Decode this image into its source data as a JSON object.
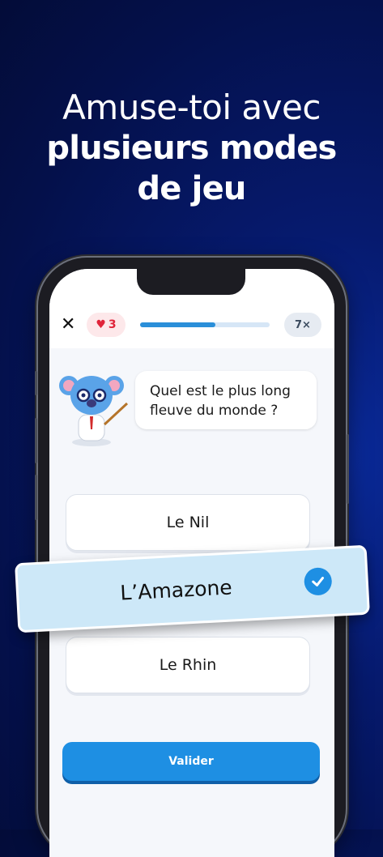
{
  "headline": {
    "line1": "Amuse-toi avec",
    "line2": "plusieurs modes",
    "line3": "de jeu"
  },
  "quiz": {
    "close_icon": "close-icon",
    "lives": "3",
    "progress_fraction": 0.58,
    "multiplier": "7×",
    "question": "Quel est le plus long fleuve du monde ?",
    "answers": [
      "Le Nil",
      "L’Amazone",
      "Le Rhin"
    ],
    "selected_answer": "L’Amazone",
    "validate_label": "Valider"
  },
  "colors": {
    "background": "#061a6e",
    "accent": "#1e8fe3",
    "heart": "#e0243a",
    "selected_card": "#cde8f8"
  }
}
